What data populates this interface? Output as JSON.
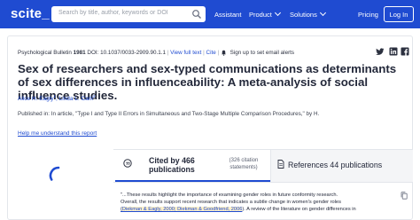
{
  "nav": {
    "logo": "scite_",
    "search_placeholder": "Search by title, author, keywords or DOI",
    "items": [
      {
        "label": "Assistant",
        "has_dropdown": false
      },
      {
        "label": "Product",
        "has_dropdown": true
      },
      {
        "label": "Solutions",
        "has_dropdown": true
      },
      {
        "label": "Pricing",
        "has_dropdown": false
      }
    ],
    "login": "Log In",
    "brand_color": "#1f4bd1"
  },
  "article": {
    "journal": "Psychological Bulletin",
    "year": "1981",
    "doi": "DOI: 10.1037/0033-2909.90.1.1",
    "view_full_text": "View full text",
    "cite": "Cite",
    "alert": "Sign up to set email alerts",
    "title": "Sex of researchers and sex-typed communications as determinants of sex differences in influenceability: A meta-analysis of social influence studies.",
    "authors": [
      {
        "name": "Alice H. Eagly",
        "sup": "1"
      },
      {
        "name": "Linda L. Carli",
        "sup": "2"
      }
    ],
    "published_in": "Published in: In article, \"Type I and Type II Errors in Simultaneous and Two-Stage Multiple Comparison Procedures,\" by H.",
    "help_link": "Help me understand this report"
  },
  "tabs": {
    "cited_count": "Cited by 466 publications",
    "cited_statements": "(326 citation statements)",
    "references": "References 44 publications"
  },
  "snippet": {
    "line1": "\"...These results highlight the importance of examining gender roles in future conformity research.",
    "line2": "Overall, the results support recent research that indicates a subtle change in women's gender roles",
    "citation": "(Diekman & Eagly, 2000; Diekman & Goodfriend, 2006",
    "line3_rest": "). A review of the literature on gender differences in"
  }
}
